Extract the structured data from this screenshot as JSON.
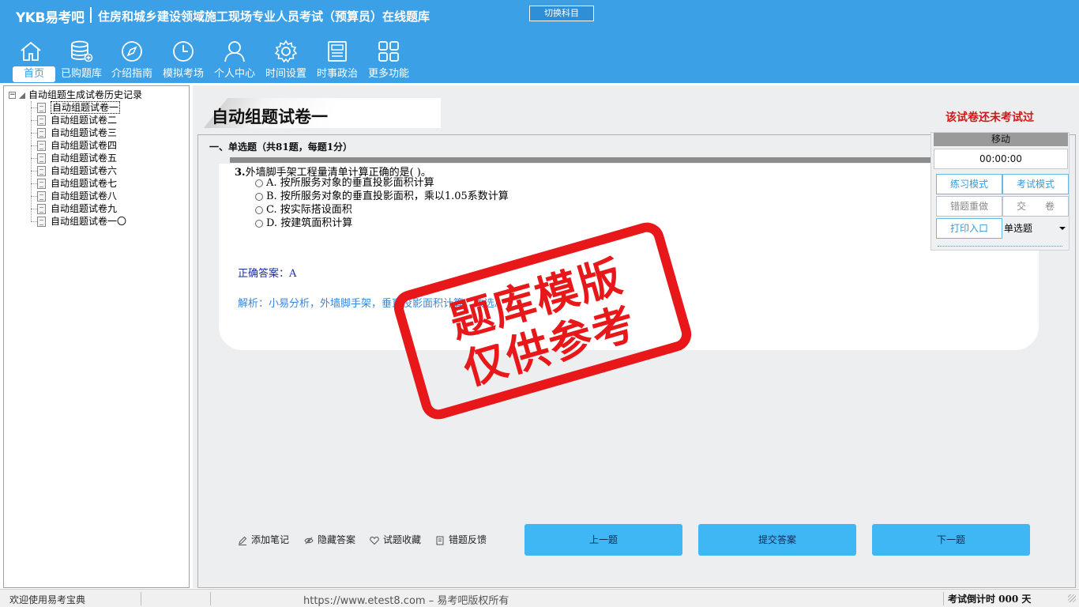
{
  "header": {
    "logo": "YKB易考吧",
    "title": "住房和城乡建设领域施工现场专业人员考试（预算员）在线题库",
    "switch_subject": "切换科目"
  },
  "nav": [
    {
      "label": "首页",
      "icon": "home-icon"
    },
    {
      "label": "已购题库",
      "icon": "database-icon"
    },
    {
      "label": "介绍指南",
      "icon": "compass-icon"
    },
    {
      "label": "模拟考场",
      "icon": "clock-icon"
    },
    {
      "label": "个人中心",
      "icon": "user-icon"
    },
    {
      "label": "时间设置",
      "icon": "gear-icon"
    },
    {
      "label": "时事政治",
      "icon": "newspaper-icon"
    },
    {
      "label": "更多功能",
      "icon": "grid-icon"
    }
  ],
  "tree": {
    "root": "自动组题生成试卷历史记录",
    "items": [
      "自动组题试卷一",
      "自动组题试卷二",
      "自动组题试卷三",
      "自动组题试卷四",
      "自动组题试卷五",
      "自动组题试卷六",
      "自动组题试卷七",
      "自动组题试卷八",
      "自动组题试卷九",
      "自动组题试卷一〇"
    ],
    "selected_index": 0
  },
  "paper": {
    "title": "自动组题试卷一",
    "status": "该试卷还未考试过",
    "section": "一、单选题（共81题，每题1分）"
  },
  "question": {
    "number": "3.",
    "stem": "外墙脚手架工程量清单计算正确的是(  )。",
    "options": [
      "A. 按所服务对象的垂直投影面积计算",
      "B. 按所服务对象的垂直投影面积，乘以1.05系数计算",
      "C. 按实际搭设面积",
      "D. 按建筑面积计算"
    ],
    "answer": "正确答案：A",
    "analysis": "解析：小易分析，外墙脚手架，垂直投影面积计算，故选A"
  },
  "tools": {
    "note": "添加笔记",
    "hide_answer": "隐藏答案",
    "favorite": "试题收藏",
    "feedback": "错题反馈"
  },
  "buttons": {
    "prev": "上一题",
    "submit": "提交答案",
    "next": "下一题"
  },
  "panel": {
    "move": "移动",
    "timer": "00:00:00",
    "practice": "练习模式",
    "exam": "考试模式",
    "redo_wrong": "错题重做",
    "hand_in": "交　　卷",
    "print": "打印入口",
    "question_type": "单选题"
  },
  "statusbar": {
    "welcome": "欢迎使用易考宝典",
    "copyright": "https://www.etest8.com – 易考吧版权所有",
    "countdown": "考试倒计时 000 天"
  },
  "watermark": {
    "line1": "题库模版",
    "line2": "仅供参考"
  },
  "colors": {
    "header": "#3ba0e6",
    "button": "#3fb7f4",
    "stamp": "#e8171a",
    "status_red": "#d01818"
  }
}
